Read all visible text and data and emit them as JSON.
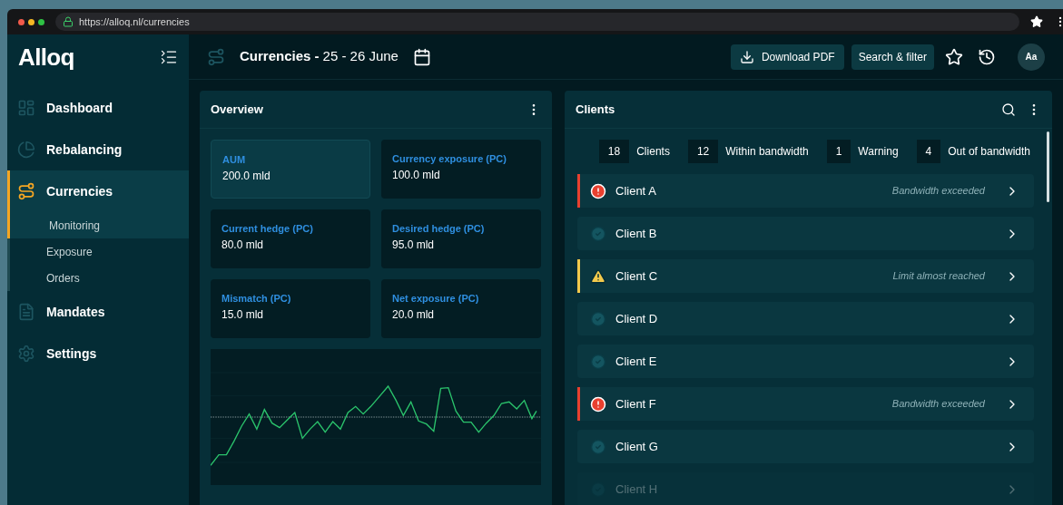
{
  "browser": {
    "url": "https://alloq.nl/currencies"
  },
  "sidebar": {
    "logo": "Alloq",
    "items": [
      {
        "label": "Dashboard",
        "selected": false,
        "expanded": false
      },
      {
        "label": "Rebalancing",
        "selected": false,
        "expanded": false
      },
      {
        "label": "Currencies",
        "selected": true,
        "expanded": true,
        "children": [
          {
            "label": "Monitoring",
            "selected": true
          },
          {
            "label": "Exposure",
            "selected": false
          },
          {
            "label": "Orders",
            "selected": false
          }
        ]
      },
      {
        "label": "Mandates",
        "selected": false,
        "expanded": false
      },
      {
        "label": "Settings",
        "selected": false,
        "expanded": false
      }
    ]
  },
  "header": {
    "title": "Currencies -",
    "date_range": "25 - 26 June",
    "download_button": "Download PDF",
    "filter_button": "Search & filter",
    "avatar": "Aa"
  },
  "overview": {
    "title": "Overview",
    "metrics": [
      {
        "label": "AUM",
        "value": "200.0 mld",
        "selected": true
      },
      {
        "label": "Currency exposure (PC)",
        "value": "100.0 mld",
        "selected": false
      },
      {
        "label": "Current hedge (PC)",
        "value": "80.0 mld",
        "selected": false
      },
      {
        "label": "Desired hedge (PC)",
        "value": "95.0 mld",
        "selected": false
      },
      {
        "label": "Mismatch (PC)",
        "value": "15.0 mld",
        "selected": false
      },
      {
        "label": "Net exposure (PC)",
        "value": "20.0 mld",
        "selected": false
      }
    ]
  },
  "clients": {
    "title": "Clients",
    "summary": [
      {
        "count": "18",
        "label": "Clients"
      },
      {
        "count": "12",
        "label": "Within bandwidth"
      },
      {
        "count": "1",
        "label": "Warning"
      },
      {
        "count": "4",
        "label": "Out of bandwidth"
      }
    ],
    "rows": [
      {
        "name": "Client A",
        "kind": "error",
        "note": "Bandwidth exceeded",
        "faded": false
      },
      {
        "name": "Client B",
        "kind": "ok",
        "faded": false
      },
      {
        "name": "Client C",
        "kind": "warning",
        "note": "Limit almost reached",
        "faded": false
      },
      {
        "name": "Client D",
        "kind": "ok",
        "faded": false
      },
      {
        "name": "Client E",
        "kind": "ok",
        "faded": false
      },
      {
        "name": "Client F",
        "kind": "error",
        "note": "Bandwidth exceeded",
        "faded": false
      },
      {
        "name": "Client G",
        "kind": "ok",
        "faded": false
      },
      {
        "name": "Client H",
        "kind": "ok",
        "faded": true
      }
    ]
  }
}
